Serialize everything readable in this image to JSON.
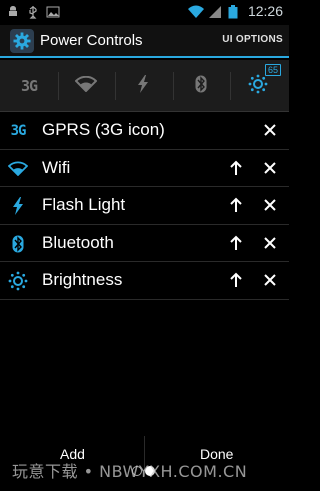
{
  "status": {
    "time": "12:26",
    "battery_level": "full"
  },
  "titlebar": {
    "title": "Power Controls",
    "options_label": "UI OPTIONS"
  },
  "widget": {
    "toggles": [
      {
        "name": "3g",
        "label": "3G"
      },
      {
        "name": "wifi"
      },
      {
        "name": "flash"
      },
      {
        "name": "bluetooth"
      },
      {
        "name": "brightness"
      }
    ],
    "battery_badge": "65",
    "accent": "#2aa9e0"
  },
  "list": {
    "items": [
      {
        "label": "GPRS (3G icon)",
        "icon": "3g-icon",
        "icon_text": "3G",
        "can_move_up": false
      },
      {
        "label": "Wifi",
        "icon": "wifi-icon",
        "can_move_up": true
      },
      {
        "label": "Flash Light",
        "icon": "flash-icon",
        "can_move_up": true
      },
      {
        "label": "Bluetooth",
        "icon": "bluetooth-icon",
        "can_move_up": true
      },
      {
        "label": "Brightness",
        "icon": "brightness-icon",
        "can_move_up": true
      }
    ]
  },
  "footer": {
    "add_label": "Add",
    "done_label": "Done",
    "page_count": 2,
    "active_page": 2,
    "watermark": "玩意下载 • NBWYXH.COM.CN"
  }
}
